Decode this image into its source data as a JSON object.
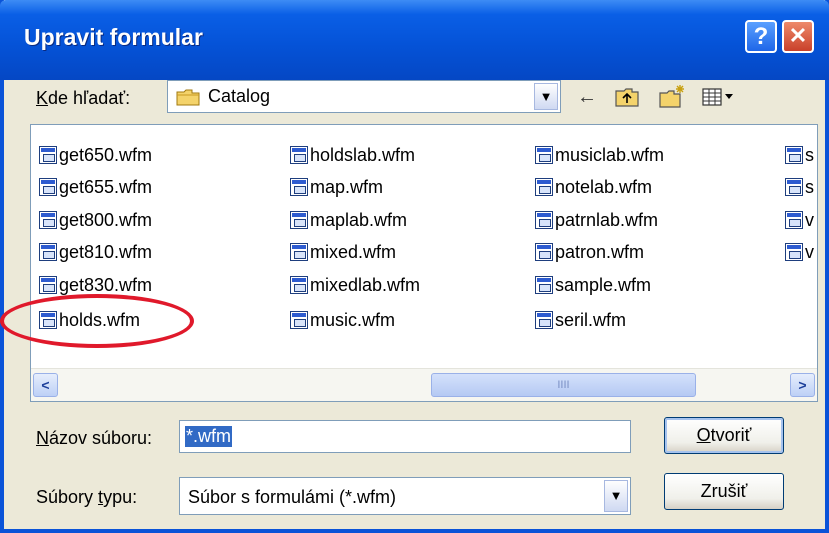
{
  "dialog": {
    "title": "Upravit formular",
    "help_label": "?",
    "close_label": "✕"
  },
  "lookin": {
    "label_key": "K",
    "label_rest": "de hľadať:",
    "value": "Catalog"
  },
  "toolbar": {
    "back_icon": "←",
    "up_icon": "folder-up-icon",
    "new_folder_icon": "new-folder-icon",
    "views_icon": "views-menu-icon"
  },
  "files": {
    "col1": [
      "get650.wfm",
      "get655.wfm",
      "get800.wfm",
      "get810.wfm",
      "get830.wfm",
      "holds.wfm"
    ],
    "col2": [
      "holdslab.wfm",
      "map.wfm",
      "maplab.wfm",
      "mixed.wfm",
      "mixedlab.wfm",
      "music.wfm"
    ],
    "col3": [
      "musiclab.wfm",
      "notelab.wfm",
      "patrnlab.wfm",
      "patron.wfm",
      "sample.wfm",
      "seril.wfm"
    ],
    "col4": [
      "s",
      "s",
      "v",
      "v"
    ]
  },
  "scrollbar": {
    "left_arrow": "<",
    "right_arrow": ">",
    "thumb_grip": "IIII"
  },
  "filename": {
    "label_key": "N",
    "label_rest": "ázov súboru:",
    "value": "*.wfm"
  },
  "filetype": {
    "label_before": "Súbory ",
    "label_key": "t",
    "label_rest": "ypu:",
    "value": "Súbor s formulámi (*.wfm)"
  },
  "buttons": {
    "open_key": "O",
    "open_rest": "tvoriť",
    "cancel": "Zrušiť"
  },
  "colors": {
    "titlebar": "#0553d8",
    "highlight_ellipse": "#e0192b",
    "selection": "#316ac5"
  }
}
